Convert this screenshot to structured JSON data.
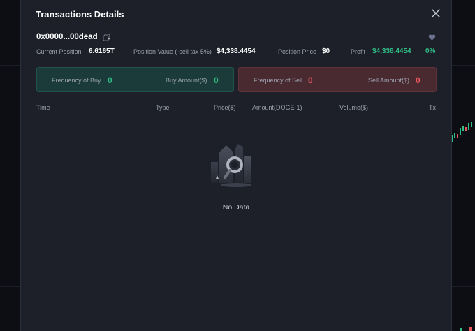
{
  "modal": {
    "title": "Transactions Details",
    "address": "0x0000...00dead"
  },
  "stats": {
    "current_position_label": "Current Position",
    "current_position_value": "6.6165T",
    "position_value_label": "Position Value (-sell tax 5%)",
    "position_value_value": "$4,338.4454",
    "position_price_label": "Position Price",
    "position_price_value": "$0",
    "profit_label": "Profit",
    "profit_value": "$4,338.4454",
    "profit_percent": "0%"
  },
  "buy_panel": {
    "frequency_label": "Frequency of Buy",
    "frequency_value": "0",
    "amount_label": "Buy Amount($)",
    "amount_value": "0"
  },
  "sell_panel": {
    "frequency_label": "Frequency of Sell",
    "frequency_value": "0",
    "amount_label": "Sell Amount($)",
    "amount_value": "0"
  },
  "table": {
    "columns": [
      "Time",
      "Type",
      "Price($)",
      "Amount(DOGE-1)",
      "Volume($)",
      "Tx"
    ],
    "rows": []
  },
  "empty_state": {
    "text": "No Data"
  },
  "icons": {
    "close": "close-icon",
    "copy": "copy-icon",
    "favorite": "heart-icon",
    "empty": "no-data-illustration"
  },
  "colors": {
    "green": "#2fbf86",
    "red": "#e8585d",
    "modal_bg": "#1d2029",
    "buy_panel_bg": "#1a3b3a",
    "sell_panel_bg": "#4a2a31"
  }
}
